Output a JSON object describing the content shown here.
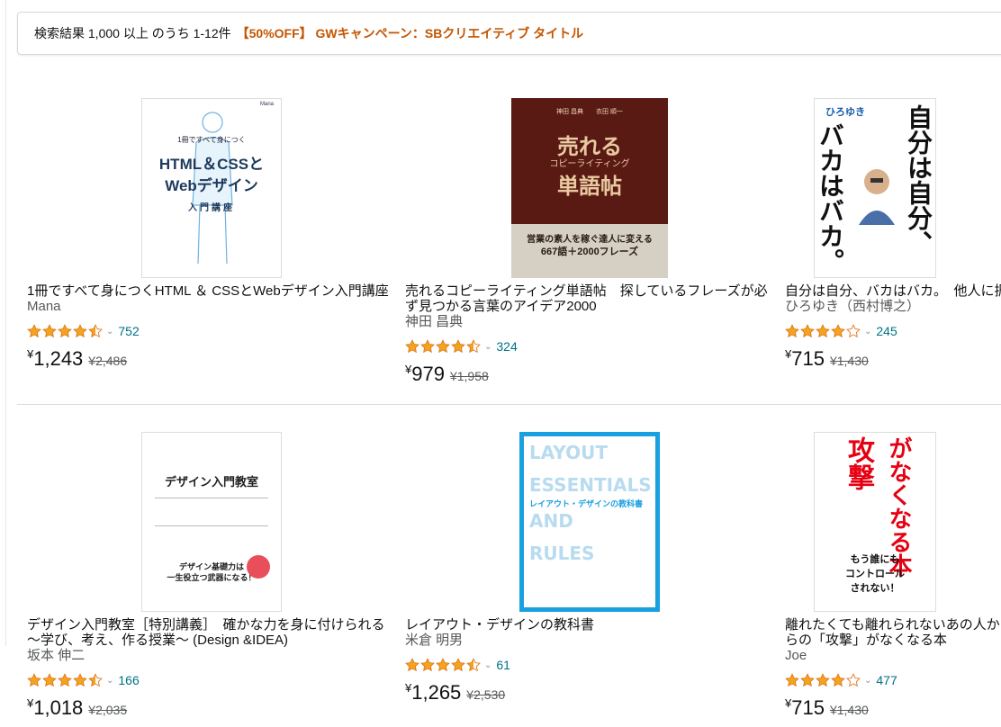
{
  "search": {
    "summary": "検索結果 1,000 以上 のうち 1-12件",
    "query": "【50%OFF】 GWキャンペーン：SBクリエイティブ タイトル"
  },
  "colors": {
    "star": "#f4a41c",
    "link": "#007185",
    "accent": "#c45500"
  },
  "products": [
    {
      "title": "1冊ですべて身につくHTML ＆ CSSとWebデザイン入門講座",
      "author": "Mana",
      "rating": 4.5,
      "reviews": "752",
      "price": "1,243",
      "list_price": "2,486",
      "cover": {
        "top": "1冊ですべて身につく",
        "main1": "HTML＆CSSと",
        "main2": "Webデザイン",
        "sub": "入門講座",
        "tag": "Mana"
      }
    },
    {
      "title": "売れるコピーライティング単語帖　探しているフレーズが必ず見つかる言葉のアイデア2000",
      "author": "神田 昌典",
      "rating": 4.5,
      "reviews": "324",
      "price": "979",
      "list_price": "1,958",
      "cover": {
        "authors": "神田 昌典　　衣田 順一",
        "main1": "売れる",
        "main2": "コピーライティング",
        "main3": "単語帖",
        "band1": "営業の素人を稼ぐ達人に変える",
        "band2": "667語＋2000フレーズ"
      }
    },
    {
      "title": "自分は自分、バカはバカ。　他人に振り回されない一人勝ちメンタル術",
      "author": "ひろゆき（西村博之）",
      "rating": 4,
      "reviews": "245",
      "price": "715",
      "list_price": "1,430",
      "cover": {
        "author": "ひろゆき",
        "main1": "自分は自分、",
        "main2": "バカはバカ。"
      }
    },
    {
      "title": "デザイン入門教室［特別講義］　確かな力を身に付けられる ～学び、考え、作る授業～ (Design &IDEA)",
      "author": "坂本 伸二",
      "rating": 4.5,
      "reviews": "166",
      "price": "1,018",
      "list_price": "2,035",
      "cover": {
        "main": "デザイン入門教室",
        "slogan1": "デザイン基礎力は",
        "slogan2": "一生役立つ武器になる！"
      }
    },
    {
      "title": "レイアウト・デザインの教科書",
      "author": "米倉 明男",
      "rating": 4.5,
      "reviews": "61",
      "price": "1,265",
      "list_price": "2,530",
      "cover": {
        "l1": "LAYOUT",
        "l2": "ESSENTIALS",
        "jp": "レイアウト・デザインの教科書",
        "l3": "AND",
        "l4": "RULES"
      }
    },
    {
      "title": "離れたくても離れられないあの人からの「攻撃」がなくなる本",
      "author": "Joe",
      "rating": 4,
      "reviews": "477",
      "price": "715",
      "list_price": "1,430",
      "cover": {
        "main1": "攻撃",
        "main2": "がなくなる本",
        "sub1": "もう誰にも",
        "sub2": "コントロール",
        "sub3": "されない！"
      }
    }
  ]
}
